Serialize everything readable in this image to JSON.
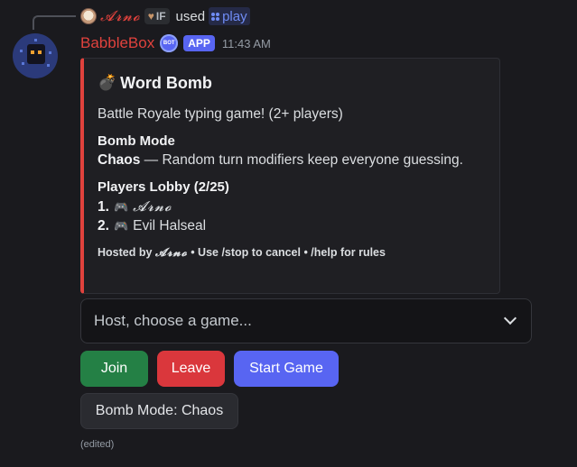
{
  "reply": {
    "user_name": "𝓐𝓻𝓷𝓸",
    "tag": "IF",
    "used_text": "used",
    "command": "play"
  },
  "message": {
    "bot_name": "BabbleBox",
    "badge": "APP",
    "verified_text": "BOT",
    "time": "11:43 AM",
    "edited": "(edited)"
  },
  "embed": {
    "accent_color": "#e0423d",
    "title_icon": "💣",
    "title": "Word Bomb",
    "description": "Battle Royale typing game! (2+ players)",
    "mode_field_name": "Bomb Mode",
    "mode_name": "Chaos",
    "mode_desc": " — Random turn modifiers keep everyone guessing.",
    "lobby_field_name": "Players Lobby (2/25)",
    "players": [
      {
        "num": "1.",
        "icon": "🎮",
        "name": "𝓐𝓻𝓷𝓸"
      },
      {
        "num": "2.",
        "icon": "🎮",
        "name": "Evil Halseal"
      }
    ],
    "footer_prefix": "Hosted by ",
    "footer_host": "𝓐𝓻𝓷𝓸",
    "footer_suffix": " • Use /stop to cancel • /help for rules"
  },
  "select": {
    "placeholder": "Host, choose a game..."
  },
  "buttons": {
    "join": "Join",
    "leave": "Leave",
    "start": "Start Game",
    "mode": "Bomb Mode: Chaos"
  }
}
